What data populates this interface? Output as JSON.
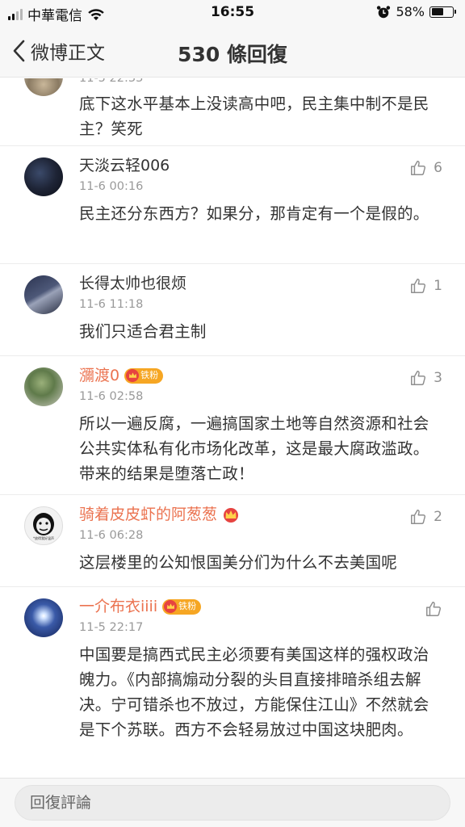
{
  "status_bar": {
    "carrier": "中華電信",
    "time": "16:55",
    "battery": "58%",
    "battery_level": 0.58
  },
  "nav": {
    "back_label": "微博正文",
    "title": "530 條回復"
  },
  "comments": [
    {
      "name": "",
      "time": "11-5 22:33",
      "text": "底下这水平基本上没读高中吧，民主集中制不是民主？笑死",
      "likes": ""
    },
    {
      "name": "天淡云轻006",
      "time": "11-6 00:16",
      "text": "民主还分东西方？如果分，那肯定有一个是假的。",
      "likes": "6"
    },
    {
      "name": "长得太帅也很烦",
      "time": "11-6 11:18",
      "text": "我们只适合君主制",
      "likes": "1"
    },
    {
      "name": "瀰渡0",
      "badge": "铁粉",
      "time": "11-6 02:58",
      "text": "所以一遍反腐，一遍搞国家土地等自然资源和社会公共实体私有化市场化改革，这是最大腐政滥政。带来的结果是堕落亡政！",
      "likes": "3"
    },
    {
      "name": "骑着皮皮虾的阿葱葱",
      "time": "11-6 06:28",
      "text": "这层楼里的公知恨国美分们为什么不去美国呢",
      "likes": "2",
      "avatar_caption": "*放得我好温声"
    },
    {
      "name": "一介布衣iiii",
      "badge": "铁粉",
      "time": "11-5 22:17",
      "text": "中国要是搞西式民主必须要有美国这样的强权政治魄力。《内部搞煽动分裂的头目直接排暗杀组去解决。宁可错杀也不放过，方能保住江山》不然就会是下个苏联。西方不会轻易放过中国这块肥肉。",
      "likes": ""
    }
  ],
  "bottom_bar": {
    "reply_placeholder": "回復評論"
  },
  "colors": {
    "accent_orange": "#eb7350",
    "text": "#333333",
    "muted": "#999999"
  }
}
